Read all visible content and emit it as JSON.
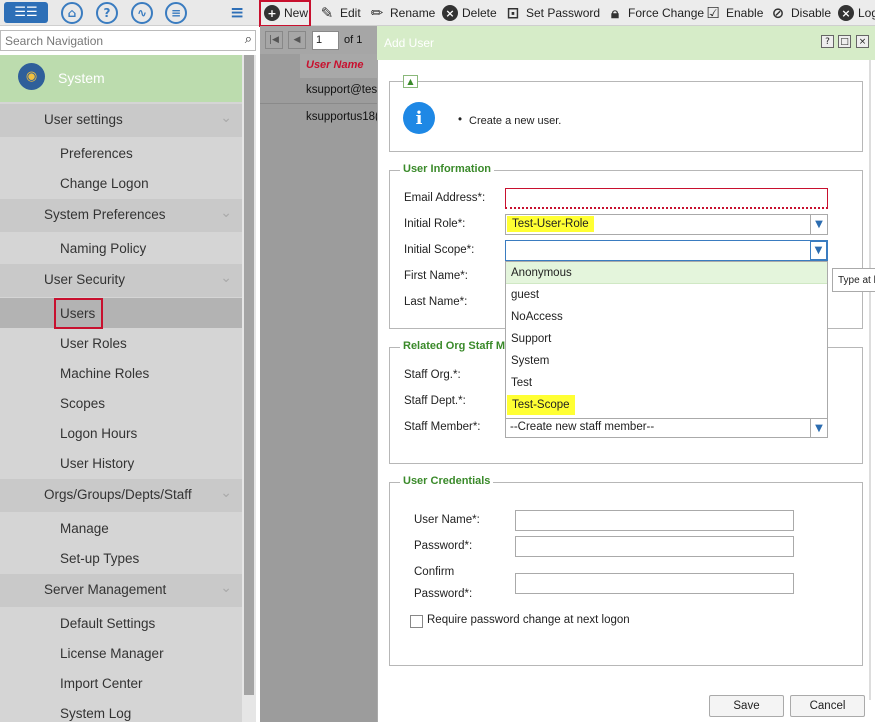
{
  "topicons": {
    "icons": [
      "list-icon",
      "bookmark-icon",
      "help-icon",
      "chart-icon",
      "database-icon",
      "menu-icon"
    ]
  },
  "toolbar": {
    "new": "New",
    "edit": "Edit",
    "rename": "Rename",
    "delete": "Delete",
    "set_password": "Set Password",
    "force_change": "Force Change",
    "enable": "Enable",
    "disable": "Disable",
    "log": "Log"
  },
  "search": {
    "placeholder": "Search Navigation"
  },
  "sidebar": {
    "header": "System",
    "sections": [
      {
        "label": "User settings",
        "items": [
          "Preferences",
          "Change Logon"
        ]
      },
      {
        "label": "System Preferences",
        "items": [
          "Naming Policy"
        ]
      },
      {
        "label": "User Security",
        "items": [
          "Users",
          "User Roles",
          "Machine Roles",
          "Scopes",
          "Logon Hours",
          "User History"
        ]
      },
      {
        "label": "Orgs/Groups/Depts/Staff",
        "items": [
          "Manage",
          "Set-up Types"
        ]
      },
      {
        "label": "Server Management",
        "items": [
          "Default Settings",
          "License Manager",
          "Import Center",
          "System Log"
        ]
      }
    ]
  },
  "grid": {
    "page": "1",
    "of": "of 1",
    "column": "User Name",
    "rows": [
      "ksupport@test",
      "ksupportus18("
    ]
  },
  "dialog": {
    "title": "Add User",
    "info": "Create a new user.",
    "user_info": {
      "legend": "User Information",
      "email_label": "Email Address*:",
      "role_label": "Initial Role*:",
      "role_value": "Test-User-Role",
      "scope_label": "Initial Scope*:",
      "first_label": "First Name*:",
      "last_label": "Last Name*:",
      "tooltip": "Type at l"
    },
    "scope_options": [
      "Anonymous",
      "guest",
      "NoAccess",
      "Support",
      "System",
      "Test",
      "Test-Scope"
    ],
    "staff": {
      "legend": "Related Org Staff Me",
      "org_label": "Staff Org.*:",
      "dept_label": "Staff Dept.*:",
      "member_label": "Staff Member*:",
      "member_value": "--Create new staff member--"
    },
    "credentials": {
      "legend": "User Credentials",
      "username_label": "User Name*:",
      "password_label": "Password*:",
      "confirm_label1": "Confirm",
      "confirm_label2": "Password*:",
      "require_label": "Require password change at next logon"
    },
    "save": "Save",
    "cancel": "Cancel"
  },
  "colors": {
    "accent": "#3a8a2a",
    "highlight": "#ffff33",
    "red_box": "#c8102e"
  }
}
